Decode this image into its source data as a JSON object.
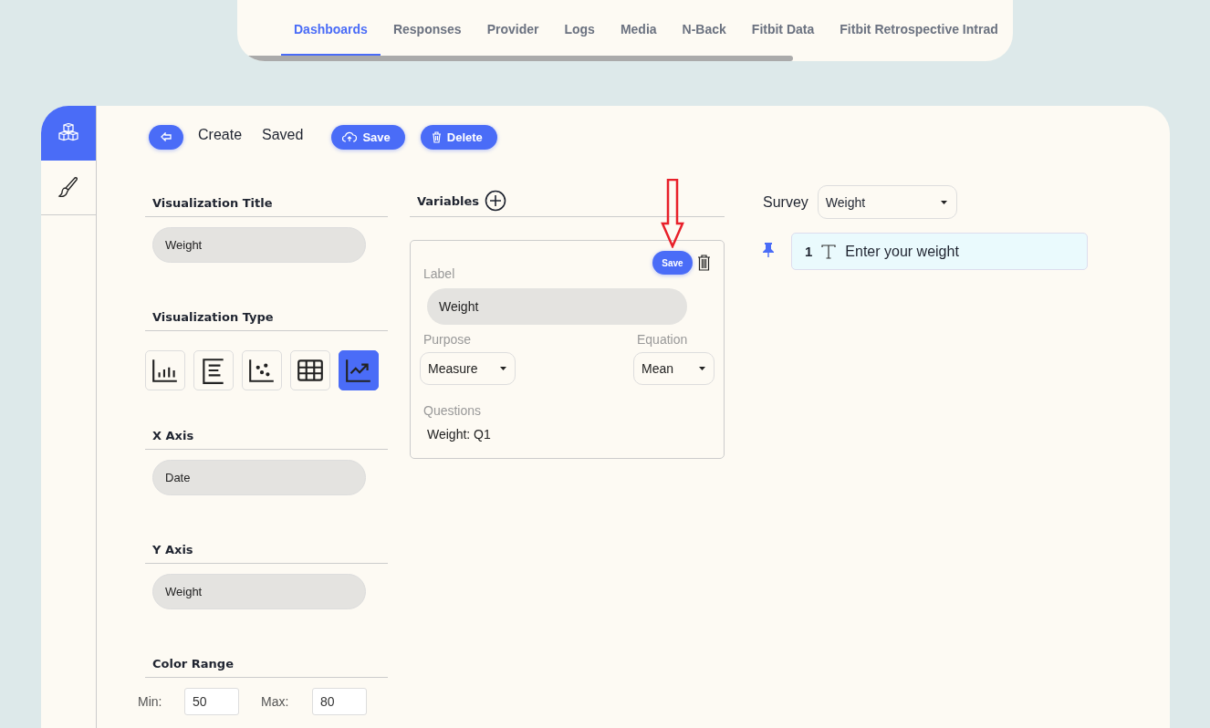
{
  "top_nav": {
    "tabs": [
      {
        "label": "Dashboards",
        "selected": true
      },
      {
        "label": "Responses",
        "selected": false
      },
      {
        "label": "Provider",
        "selected": false
      },
      {
        "label": "Logs",
        "selected": false
      },
      {
        "label": "Media",
        "selected": false
      },
      {
        "label": "N-Back",
        "selected": false
      },
      {
        "label": "Fitbit Data",
        "selected": false
      },
      {
        "label": "Fitbit Retrospective Intrad",
        "selected": false
      }
    ]
  },
  "sidebar": {
    "items": [
      {
        "selected": true
      },
      {
        "selected": false
      }
    ]
  },
  "toolbar": {
    "links": [
      "Create",
      "Saved"
    ],
    "buttons": [
      {
        "label": "Save"
      },
      {
        "label": "Delete"
      }
    ]
  },
  "visualization_title": {
    "label": "Visualization Title",
    "value": "Weight"
  },
  "visualization_type": {
    "label": "Visualization Type",
    "options": [
      {
        "selected": false
      },
      {
        "selected": false
      },
      {
        "selected": false
      },
      {
        "selected": false
      },
      {
        "selected": true
      }
    ]
  },
  "x_axis": {
    "label": "X Axis",
    "value": "Date"
  },
  "y_axis": {
    "label": "Y Axis",
    "value": "Weight"
  },
  "color_range": {
    "label": "Color Range",
    "min_label": "Min:",
    "min": "50",
    "max_label": "Max:",
    "max": "80"
  },
  "variables": {
    "title": "Variables",
    "card": {
      "save": "Save",
      "label_caption": "Label",
      "label_value": "Weight",
      "purpose_caption": "Purpose",
      "purpose": "Measure",
      "equation_caption": "Equation",
      "equation": "Mean",
      "questions_caption": "Questions",
      "questions": [
        "Weight: Q1"
      ]
    }
  },
  "survey": {
    "label": "Survey",
    "value": "Weight",
    "questions": [
      {
        "number": "1",
        "text": "Enter your weight",
        "pinned": true
      }
    ]
  }
}
